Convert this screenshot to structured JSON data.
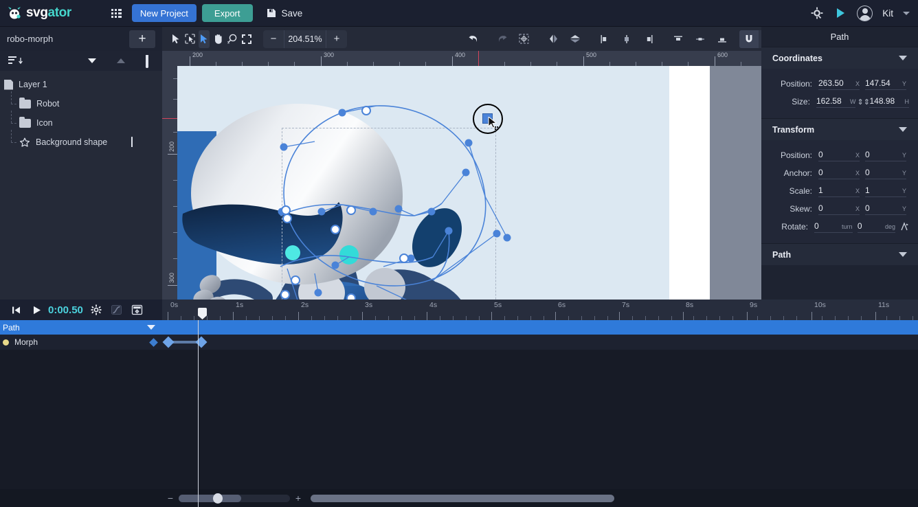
{
  "header": {
    "logo_text_white": "svg",
    "logo_text_accent": "ator",
    "apps_icon": "apps-grid-icon",
    "new_project_label": "New Project",
    "export_label": "Export",
    "save_label": "Save",
    "settings_icon": "settings-gear-icon",
    "preview_icon": "play-preview-icon",
    "user_name": "Kit",
    "user_caret": "chevron-down-icon"
  },
  "left_panel": {
    "project_name": "robo-morph",
    "add_label": "+",
    "tools": {
      "sort_icon": "sort-layers-icon",
      "collapse_down_icon": "chevron-down-icon",
      "collapse_up_icon": "chevron-up-icon",
      "delete_icon": "trash-icon"
    },
    "layers": [
      {
        "label": "Layer 1",
        "icon": "file-icon",
        "depth": 0,
        "locked": false
      },
      {
        "label": "Robot",
        "icon": "folder-icon",
        "depth": 1,
        "locked": false
      },
      {
        "label": "Icon",
        "icon": "folder-icon",
        "depth": 1,
        "locked": false
      },
      {
        "label": "Background shape",
        "icon": "star-shape-icon",
        "depth": 1,
        "locked": true
      }
    ]
  },
  "toolbar": {
    "tools": [
      {
        "name": "select-tool",
        "active": false
      },
      {
        "name": "transform-tool",
        "active": false
      },
      {
        "name": "node-edit-tool",
        "active": true
      },
      {
        "name": "hand-pan-tool",
        "active": false
      },
      {
        "name": "zoom-tool",
        "active": false
      },
      {
        "name": "fit-screen-tool",
        "active": false
      }
    ],
    "zoom_out_label": "−",
    "zoom_value": "204.51%",
    "zoom_in_label": "+",
    "undo_icon": "undo-icon",
    "redo_icon": "redo-icon",
    "right_tools": [
      "anchor-center-icon",
      "flip-horizontal-icon",
      "flip-vertical-icon",
      "align-left-icon",
      "align-center-horizontal-icon",
      "align-right-icon",
      "align-top-icon",
      "align-middle-vertical-icon",
      "align-bottom-icon"
    ],
    "snap_icon": "magnet-snap-icon",
    "grid_icon": "grid-icon",
    "ruler_icon": "ruler-icon"
  },
  "canvas": {
    "ruler_h_labels": [
      "200",
      "300",
      "400",
      "500",
      "600"
    ],
    "ruler_v_labels": [
      "200",
      "300"
    ],
    "artwork_description": "robot character illustration with path nodes selected",
    "colors": {
      "page": "#ffffff",
      "art_background": "#dce8f2",
      "art_band": "#2f6cb5",
      "node_blue": "#4a83d8",
      "canvas_outside": "#808898"
    }
  },
  "right_panel": {
    "title": "Path",
    "sections": [
      {
        "name": "Coordinates",
        "rows": [
          {
            "label": "Position:",
            "x": "263.50",
            "x_suffix": "X",
            "y": "147.54",
            "y_suffix": "Y"
          },
          {
            "label": "Size:",
            "x": "162.58",
            "x_suffix": "W",
            "link_icon": "link-ratio-icon",
            "y": "148.98",
            "y_suffix": "H"
          }
        ]
      },
      {
        "name": "Transform",
        "rows": [
          {
            "label": "Position:",
            "x": "0",
            "x_suffix": "X",
            "y": "0",
            "y_suffix": "Y"
          },
          {
            "label": "Anchor:",
            "x": "0",
            "x_suffix": "X",
            "y": "0",
            "y_suffix": "Y"
          },
          {
            "label": "Scale:",
            "x": "1",
            "x_suffix": "X",
            "y": "1",
            "y_suffix": "Y"
          },
          {
            "label": "Skew:",
            "x": "0",
            "x_suffix": "X",
            "y": "0",
            "y_suffix": "Y"
          },
          {
            "label": "Rotate:",
            "x": "0",
            "x_suffix": "turn",
            "y": "0",
            "y_suffix": "deg",
            "extra_icon": "rotate-anchor-icon"
          }
        ]
      },
      {
        "name": "Path",
        "rows": []
      }
    ]
  },
  "timeline": {
    "controls": {
      "rewind_icon": "skip-to-start-icon",
      "play_icon": "play-icon",
      "current_time": "0:00.50",
      "settings_icon": "gear-icon",
      "easing_icon": "easing-curve-icon",
      "keyframe_panel_icon": "keyframe-options-icon"
    },
    "ruler_labels": [
      "0s",
      "1s",
      "2s",
      "3s",
      "4s",
      "5s",
      "6s",
      "7s",
      "8s",
      "9s",
      "10s",
      "11s"
    ],
    "property_row": {
      "label": "Path",
      "caret_icon": "chevron-down-icon"
    },
    "animator_row": {
      "label": "Morph",
      "dot_color": "#e8d98a",
      "add_keyframe_icon": "keyframe-diamond-icon",
      "keyframes_seconds": [
        0.0,
        0.5
      ]
    },
    "zoom_slider": {
      "minus_label": "−",
      "plus_label": "+",
      "value_percent": 33
    }
  }
}
